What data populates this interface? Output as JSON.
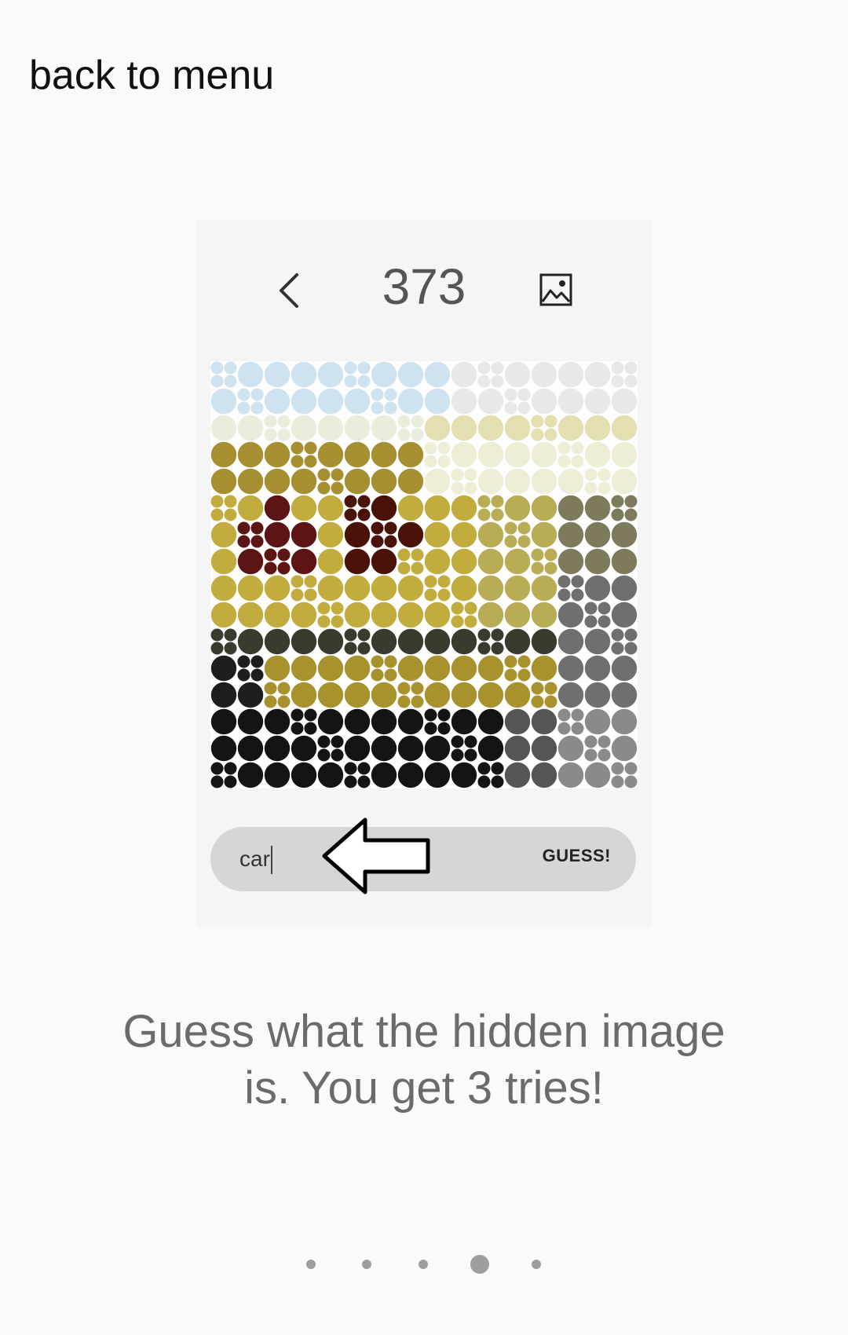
{
  "nav": {
    "back_label": "back to menu"
  },
  "puzzle": {
    "number": "373",
    "guess_value": "car",
    "guess_button_label": "GUESS!"
  },
  "instruction": {
    "line1": "Guess what the hidden image",
    "line2": "is. You get 3 tries!"
  },
  "icons": {
    "prev": "chevron-left-icon",
    "image": "image-icon",
    "pointer": "arrow-left-icon"
  },
  "pager": {
    "total": 5,
    "active_index": 3
  },
  "colors": {
    "background": "#fafafa",
    "card": "#f5f5f5",
    "input_bar": "#d6d6d6",
    "instruction_text": "#6b6b6b",
    "dot": "#9e9e9e"
  }
}
